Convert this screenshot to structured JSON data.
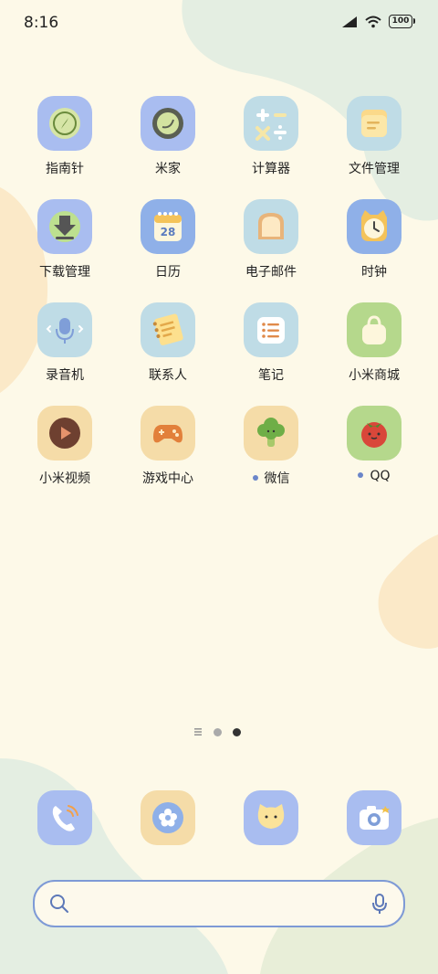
{
  "status_bar": {
    "time": "8:16",
    "battery": "100"
  },
  "apps": [
    {
      "label": "指南针",
      "icon": "compass-icon",
      "tile_color": "#a9bdf0",
      "dot": false
    },
    {
      "label": "米家",
      "icon": "mijia-icon",
      "tile_color": "#a9bdf0",
      "dot": false
    },
    {
      "label": "计算器",
      "icon": "calculator-icon",
      "tile_color": "#bfdce6",
      "dot": false
    },
    {
      "label": "文件管理",
      "icon": "folder-icon",
      "tile_color": "#bfdce6",
      "dot": false
    },
    {
      "label": "下载管理",
      "icon": "download-icon",
      "tile_color": "#a9bdf0",
      "dot": false
    },
    {
      "label": "日历",
      "icon": "calendar-icon",
      "tile_color": "#8fb0e8",
      "dot": false
    },
    {
      "label": "电子邮件",
      "icon": "email-icon",
      "tile_color": "#bfdce6",
      "dot": false
    },
    {
      "label": "时钟",
      "icon": "clock-icon",
      "tile_color": "#8fb0e8",
      "dot": false
    },
    {
      "label": "录音机",
      "icon": "microphone-icon",
      "tile_color": "#bfdce6",
      "dot": false
    },
    {
      "label": "联系人",
      "icon": "contacts-icon",
      "tile_color": "#bfdce6",
      "dot": false
    },
    {
      "label": "笔记",
      "icon": "notes-icon",
      "tile_color": "#bfdce6",
      "dot": false
    },
    {
      "label": "小米商城",
      "icon": "shopping-bag-icon",
      "tile_color": "#b5d88c",
      "dot": false
    },
    {
      "label": "小米视频",
      "icon": "video-play-icon",
      "tile_color": "#f5dca8",
      "dot": false
    },
    {
      "label": "游戏中心",
      "icon": "gamepad-icon",
      "tile_color": "#f5dca8",
      "dot": false
    },
    {
      "label": "微信",
      "icon": "wechat-broccoli-icon",
      "tile_color": "#f5dca8",
      "dot": true
    },
    {
      "label": "QQ",
      "icon": "qq-tomato-icon",
      "tile_color": "#b5d88c",
      "dot": true
    }
  ],
  "calendar_day": "28",
  "dock": [
    {
      "icon": "phone-icon",
      "tile_color": "#a9bdf0"
    },
    {
      "icon": "flower-icon",
      "tile_color": "#f5dca8"
    },
    {
      "icon": "cat-face-icon",
      "tile_color": "#a9bdf0"
    },
    {
      "icon": "camera-icon",
      "tile_color": "#a9bdf0"
    }
  ],
  "page_indicator": {
    "pages": 3,
    "current": 3
  },
  "search_bar": {
    "placeholder": ""
  },
  "colors": {
    "background": "#fdf9e8",
    "accent": "#7e9ad6"
  }
}
